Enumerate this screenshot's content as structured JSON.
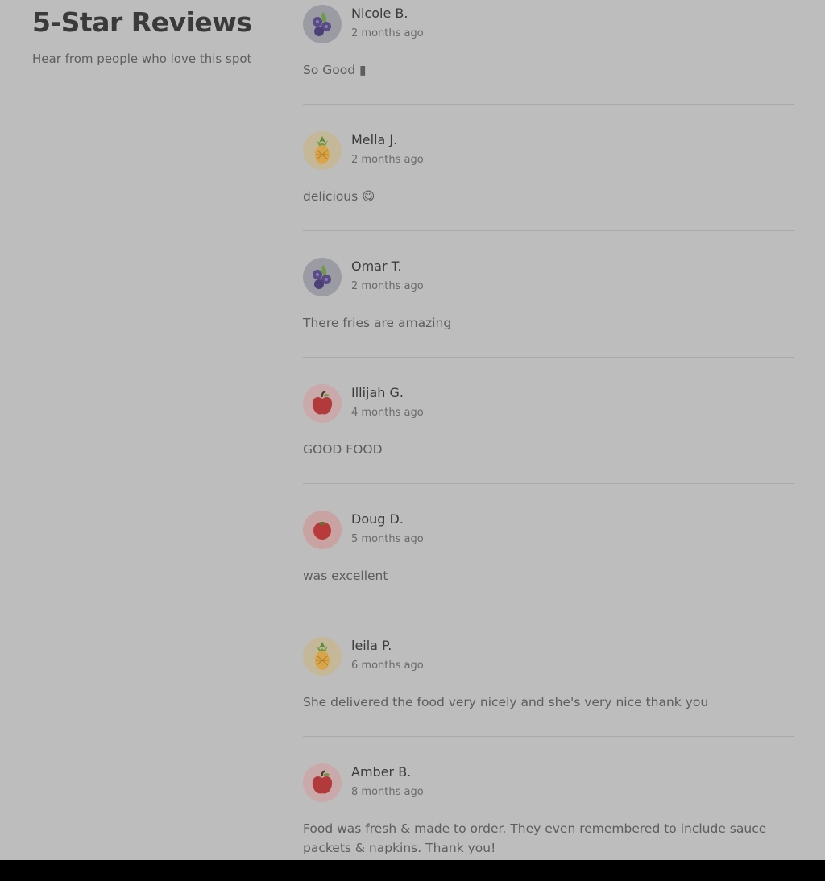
{
  "header": {
    "title": "5-Star Reviews",
    "subtitle": "Hear from people who love this spot"
  },
  "reviews": [
    {
      "name": "Nicole B.",
      "date": "2 months ago",
      "text": "So Good ▮",
      "avatar": "blueberry-icon",
      "avatar_bg": "#9a9ba3"
    },
    {
      "name": "Mella J.",
      "date": "2 months ago",
      "text": "delicious 😋",
      "avatar": "pineapple-icon",
      "avatar_bg": "#c5b899"
    },
    {
      "name": "Omar T.",
      "date": "2 months ago",
      "text": "There fries are amazing",
      "avatar": "blueberry-icon",
      "avatar_bg": "#9a9ba3"
    },
    {
      "name": "Illijah G.",
      "date": "4 months ago",
      "text": "GOOD FOOD",
      "avatar": "apple-icon",
      "avatar_bg": "#c9a9a9"
    },
    {
      "name": "Doug D.",
      "date": "5 months ago",
      "text": "was excellent",
      "avatar": "tomato-icon",
      "avatar_bg": "#c9a2a2"
    },
    {
      "name": "leila P.",
      "date": "6 months ago",
      "text": "She delivered the food very nicely and she's very nice thank you",
      "avatar": "pineapple-icon",
      "avatar_bg": "#c5b899"
    },
    {
      "name": "Amber B.",
      "date": "8 months ago",
      "text": "Food was fresh & made to order. They even remembered to include sauce packets & napkins. Thank you!",
      "avatar": "apple-icon",
      "avatar_bg": "#c9a9a9"
    }
  ]
}
